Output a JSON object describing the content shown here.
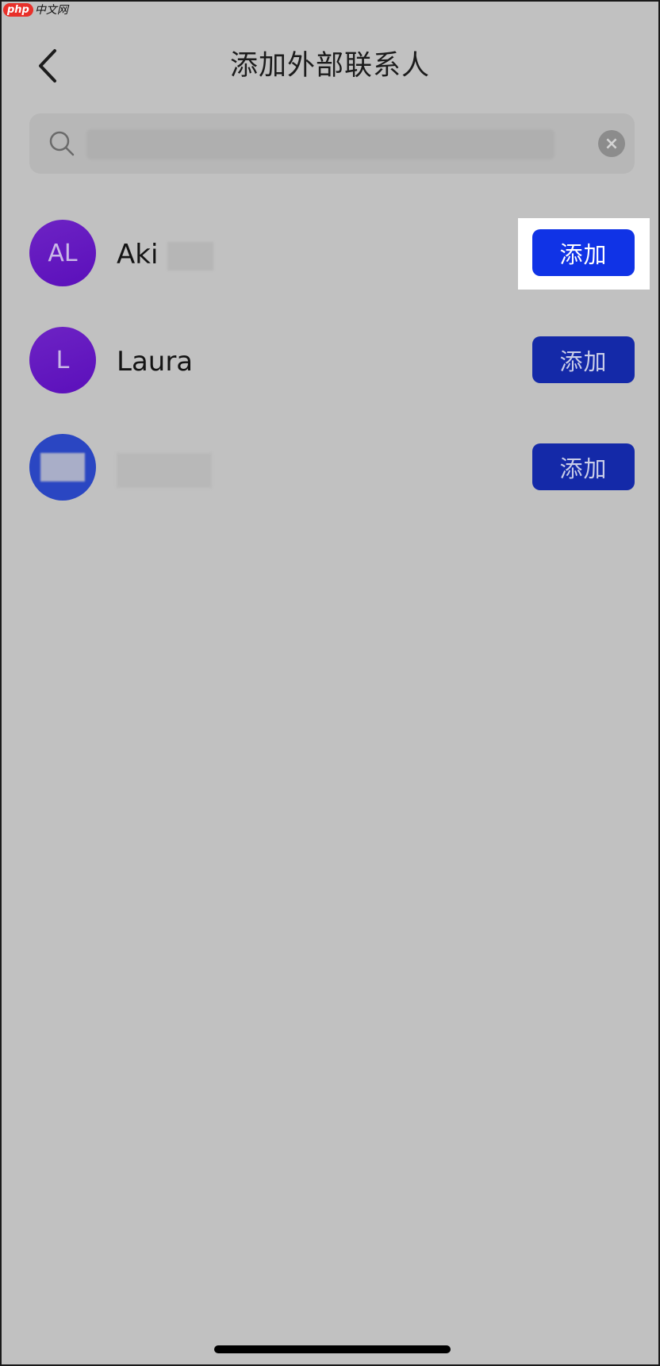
{
  "watermark": {
    "logo": "php",
    "text": "中文网"
  },
  "header": {
    "title": "添加外部联系人",
    "back_icon": "chevron-left-icon"
  },
  "search": {
    "value": "",
    "placeholder": "",
    "clear_icon": "×"
  },
  "contacts": [
    {
      "initials": "AL",
      "name": "Aki",
      "button": "添加",
      "highlighted": true
    },
    {
      "initials": "L",
      "name": "Laura",
      "button": "添加",
      "highlighted": false
    },
    {
      "initials": "",
      "name": "",
      "button": "添加",
      "highlighted": false
    }
  ],
  "colors": {
    "background": "#c1c1c1",
    "button": "#1429a8",
    "button_active": "#1033e6",
    "avatar_purple": "#6d23c4",
    "avatar_blue": "#2a46c2"
  }
}
